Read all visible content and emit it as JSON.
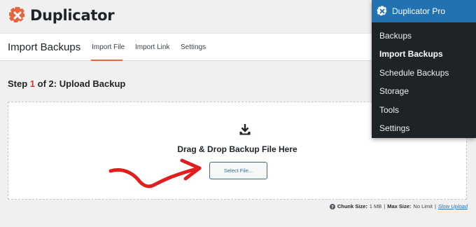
{
  "brand": {
    "name": "Duplicator",
    "accent": "#e8643c"
  },
  "header": {
    "title": "Import Backups",
    "tabs": [
      {
        "label": "Import File",
        "active": true
      },
      {
        "label": "Import Link",
        "active": false
      },
      {
        "label": "Settings",
        "active": false
      }
    ]
  },
  "step": {
    "prefix": "Step",
    "current": "1",
    "middle": "of 2:",
    "title": "Upload Backup"
  },
  "dropzone": {
    "icon": "download-icon",
    "text": "Drag & Drop Backup File Here",
    "button_label": "Select File..."
  },
  "footer": {
    "chunk_label": "Chunk Size:",
    "chunk_value": "1 MB",
    "separator": "|",
    "max_label": "Max Size:",
    "max_value": "No Limit",
    "slow_upload": "Slow Upload",
    "icon": "help-icon"
  },
  "menu": {
    "title": "Duplicator Pro",
    "header_color": "#2271b1",
    "items": [
      {
        "label": "Backups",
        "current": false
      },
      {
        "label": "Import Backups",
        "current": true
      },
      {
        "label": "Schedule Backups",
        "current": false
      },
      {
        "label": "Storage",
        "current": false
      },
      {
        "label": "Tools",
        "current": false
      },
      {
        "label": "Settings",
        "current": false
      }
    ]
  }
}
